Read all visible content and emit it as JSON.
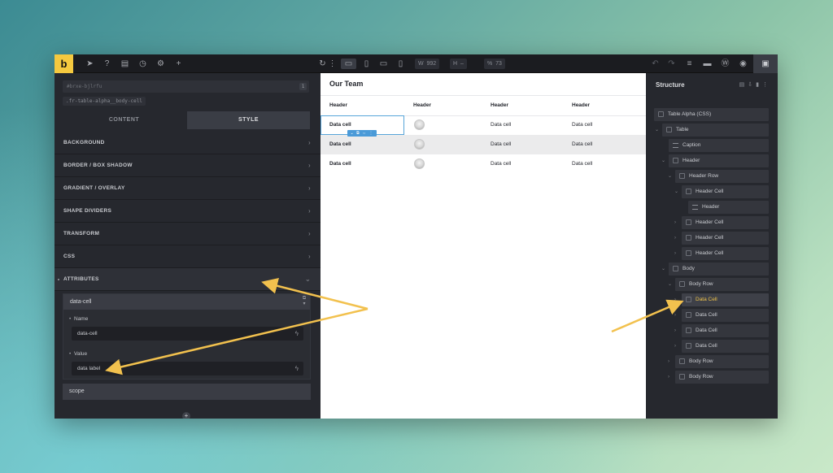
{
  "topbar": {
    "logo": "b",
    "width_label": "W",
    "width_value": "992",
    "height_label": "H",
    "height_value": "–",
    "zoom_label": "%",
    "zoom_value": "73"
  },
  "left_panel": {
    "element_id": "#brxe-bjlrfu",
    "id_count": "1",
    "class_chip": ".fr-table-alpha__body-cell",
    "tabs": [
      "CONTENT",
      "STYLE"
    ],
    "active_tab": "STYLE",
    "sections": [
      "BACKGROUND",
      "BORDER / BOX SHADOW",
      "GRADIENT / OVERLAY",
      "SHAPE DIVIDERS",
      "TRANSFORM",
      "CSS",
      "ATTRIBUTES"
    ],
    "attribute": {
      "title": "data-cell",
      "name_label": "Name",
      "name_value": "data-cell",
      "value_label": "Value",
      "value_value": "data label"
    },
    "second_attribute": "scope"
  },
  "canvas": {
    "title": "Our Team",
    "headers": [
      "Header",
      "Header",
      "Header",
      "Header"
    ],
    "rows": [
      [
        "Data cell",
        "",
        "Data cell",
        "Data cell"
      ],
      [
        "Data cell",
        "",
        "Data cell",
        "Data cell"
      ],
      [
        "Data cell",
        "",
        "Data cell",
        "Data cell"
      ]
    ]
  },
  "structure": {
    "title": "Structure",
    "nodes": [
      "Table Alpha (CSS)",
      "Table",
      "Caption",
      "Header",
      "Header Row",
      "Header Cell",
      "Header",
      "Header Cell",
      "Header Cell",
      "Header Cell",
      "Body",
      "Body Row",
      "Data Cell",
      "Data Cell",
      "Data Cell",
      "Data Cell",
      "Body Row",
      "Body Row"
    ],
    "active_node": "Data Cell"
  },
  "colors": {
    "accent": "#f5c93f",
    "selection": "#4a9ad8",
    "arrow": "#f2c14e"
  }
}
